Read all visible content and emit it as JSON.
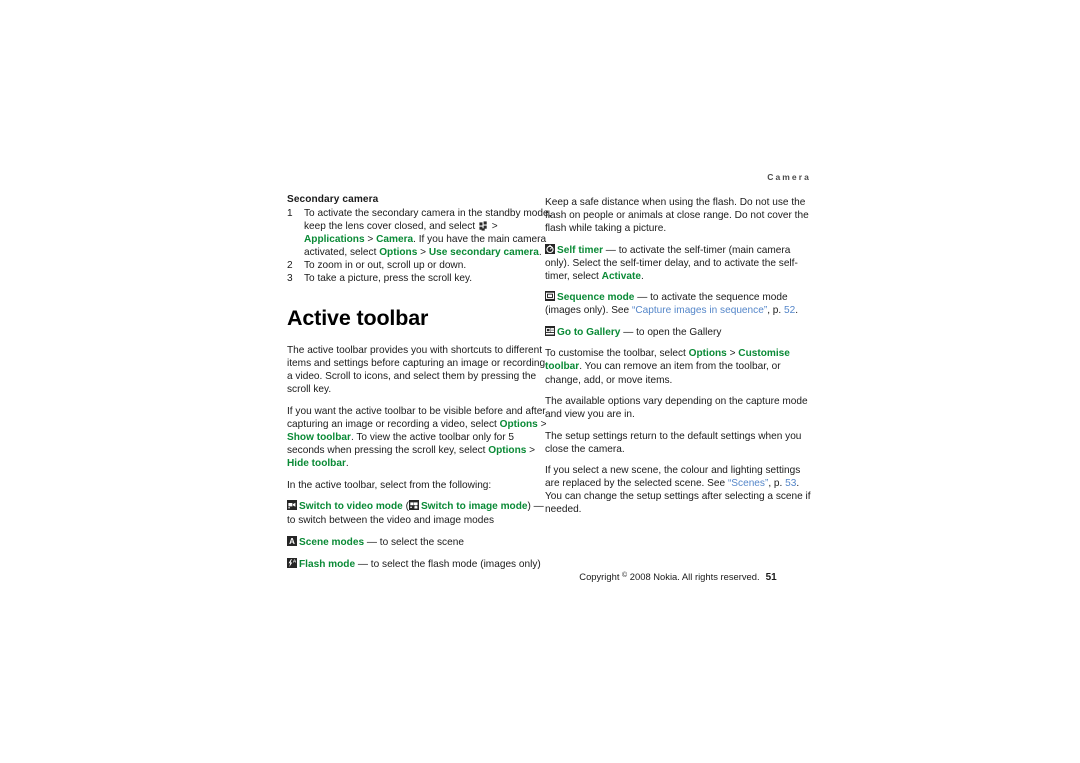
{
  "header": {
    "running_head": "Camera"
  },
  "left_column": {
    "subheading": "Secondary camera",
    "steps": [
      {
        "num": "1",
        "parts": [
          {
            "t": "To activate the secondary camera in the standby mode, keep the lens cover closed, and select ",
            "s": "plain"
          },
          {
            "t": "menu-key-icon",
            "s": "icon"
          },
          {
            "t": " > ",
            "s": "plain"
          },
          {
            "t": "Applications",
            "s": "green"
          },
          {
            "t": " > ",
            "s": "plain"
          },
          {
            "t": "Camera",
            "s": "green"
          },
          {
            "t": ". If you have the main camera activated, select ",
            "s": "plain"
          },
          {
            "t": "Options",
            "s": "green"
          },
          {
            "t": " > ",
            "s": "plain"
          },
          {
            "t": "Use secondary camera",
            "s": "green"
          },
          {
            "t": ".",
            "s": "plain"
          }
        ]
      },
      {
        "num": "2",
        "parts": [
          {
            "t": "To zoom in or out, scroll up or down.",
            "s": "plain"
          }
        ]
      },
      {
        "num": "3",
        "parts": [
          {
            "t": "To take a picture, press the scroll key.",
            "s": "plain"
          }
        ]
      }
    ],
    "chapter_title": "Active toolbar",
    "para_1": "The active toolbar provides you with shortcuts to different items and settings before capturing an image or recording a video. Scroll to icons, and select them by pressing the scroll key.",
    "para_2": [
      {
        "t": "If you want the active toolbar to be visible before and after capturing an image or recording a video, select ",
        "s": "plain"
      },
      {
        "t": "Options",
        "s": "green"
      },
      {
        "t": " > ",
        "s": "plain"
      },
      {
        "t": "Show toolbar",
        "s": "green"
      },
      {
        "t": ". To view the active toolbar only for 5 seconds when pressing the scroll key, select ",
        "s": "plain"
      },
      {
        "t": "Options",
        "s": "green"
      },
      {
        "t": " > ",
        "s": "plain"
      },
      {
        "t": "Hide toolbar",
        "s": "green"
      },
      {
        "t": ".",
        "s": "plain"
      }
    ],
    "para_3": "In the active toolbar, select from the following:",
    "toolbar_items": [
      {
        "icon": "video-mode-icon",
        "label": "Switch to video mode",
        "paren_open": " (",
        "icon2": "image-mode-icon",
        "label2": "Switch to image mode",
        "paren_close": ")",
        "desc": " — to switch between the video and image modes"
      },
      {
        "icon": "scene-modes-icon",
        "label": "Scene modes",
        "desc": " — to select the scene"
      },
      {
        "icon": "flash-mode-icon",
        "label": "Flash mode",
        "desc": " — to select the flash mode (images only)"
      }
    ]
  },
  "right_column": {
    "para_flash_warning": "Keep a safe distance when using the flash. Do not use the flash on people or animals at close range. Do not cover the flash while taking a picture.",
    "self_timer": {
      "icon": "self-timer-icon",
      "label": "Self timer",
      "desc_1": " — to activate the self-timer (main camera only). Select the self-timer delay, and to activate the self-timer, select ",
      "activate": "Activate",
      "desc_2": "."
    },
    "sequence_mode": {
      "icon": "sequence-mode-icon",
      "label": "Sequence mode",
      "desc_1": " — to activate the sequence mode (images only). See ",
      "link_text": "“Capture images in sequence”",
      "mid": ", p. ",
      "link_page": "52",
      "desc_2": "."
    },
    "go_to_gallery": {
      "icon": "go-to-gallery-icon",
      "label": "Go to Gallery",
      "desc": " — to open the Gallery"
    },
    "customise": [
      {
        "t": "To customise the toolbar, select ",
        "s": "plain"
      },
      {
        "t": "Options",
        "s": "green"
      },
      {
        "t": " > ",
        "s": "plain"
      },
      {
        "t": "Customise toolbar",
        "s": "green"
      },
      {
        "t": ". You can remove an item from the toolbar, or change, add, or move items.",
        "s": "plain"
      }
    ],
    "para_options_vary": "The available options vary depending on the capture mode and view you are in.",
    "para_setup_settings": "The setup settings return to the default settings when you close the camera.",
    "para_new_scene": {
      "t1": "If you select a new scene, the colour and lighting settings are replaced by the selected scene. See ",
      "link_text": "“Scenes”",
      "mid": ", p. ",
      "link_page": "53",
      "t2": ". You can change the setup settings after selecting a scene if needed."
    }
  },
  "footer": {
    "copyright_pre": "Copyright ",
    "copyright_sym": "©",
    "copyright_post": " 2008 Nokia. All rights reserved.",
    "page_number": "51"
  },
  "colors": {
    "green": "#0a8a36",
    "link_blue": "#5486c9",
    "text": "#1a1a1a",
    "icon_bg": "#262626"
  }
}
